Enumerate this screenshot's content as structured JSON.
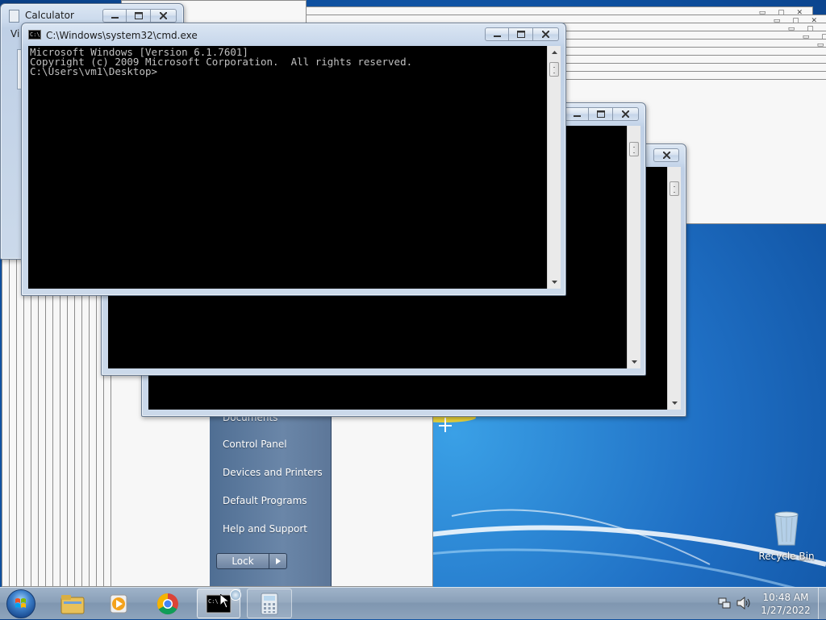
{
  "desktop": {
    "recycle_bin_label": "Recycle Bin"
  },
  "calculator_window": {
    "title": "Calculator",
    "menu_fragment": "Vi"
  },
  "cmd_window": {
    "title": "C:\\Windows\\system32\\cmd.exe",
    "lines": [
      "Microsoft Windows [Version 6.1.7601]",
      "Copyright (c) 2009 Microsoft Corporation.  All rights reserved.",
      "",
      "C:\\Users\\vm1\\Desktop>"
    ]
  },
  "start_menu": {
    "partial_item": "Documents",
    "items": [
      "Control Panel",
      "Devices and Printers",
      "Default Programs",
      "Help and Support"
    ],
    "lock_label": "Lock"
  },
  "taskbar": {
    "time": "10:48 AM",
    "date": "1/27/2022",
    "pinned": [
      "start-orb",
      "windows-explorer",
      "media-player",
      "chrome",
      "cmd",
      "calculator"
    ]
  }
}
